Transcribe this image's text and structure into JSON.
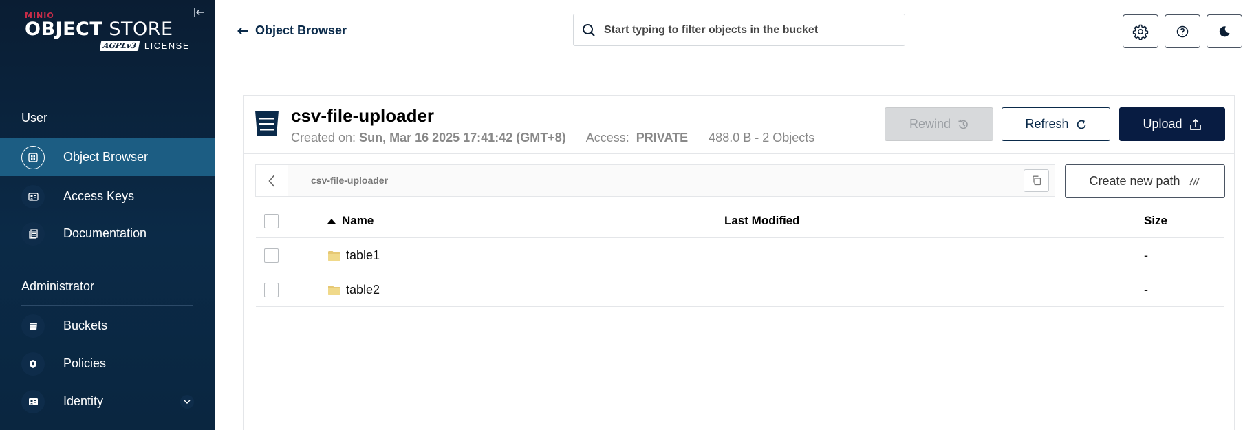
{
  "brand": {
    "minio": "MINIO",
    "title_bold": "OBJECT",
    "title_light": " STORE",
    "agpl": "AGPLv3",
    "license": "LICENSE",
    "colors": {
      "sidebar_bg": "#0b2a47",
      "active_item": "#1c5d83",
      "upload_button": "#081c42",
      "brand_red": "#c72c48"
    }
  },
  "sidebar": {
    "user_section": "User",
    "user_items": [
      {
        "label": "Object Browser",
        "icon": "object-browser-icon",
        "active": true
      },
      {
        "label": "Access Keys",
        "icon": "access-keys-icon",
        "active": false
      },
      {
        "label": "Documentation",
        "icon": "documentation-icon",
        "active": false
      }
    ],
    "admin_section": "Administrator",
    "admin_items": [
      {
        "label": "Buckets",
        "icon": "buckets-icon"
      },
      {
        "label": "Policies",
        "icon": "policies-icon"
      },
      {
        "label": "Identity",
        "icon": "identity-icon",
        "expandable": true
      }
    ]
  },
  "header": {
    "back_label": "Object Browser",
    "search_placeholder": "Start typing to filter objects in the bucket",
    "icons": [
      "settings-icon",
      "help-icon",
      "dark-mode-icon"
    ]
  },
  "bucket": {
    "name": "csv-file-uploader",
    "created_label": "Created on:",
    "created_value": "Sun, Mar 16 2025 17:41:42 (GMT+8)",
    "access_label": "Access:",
    "access_value": "PRIVATE",
    "usage": "488.0 B - 2 Objects",
    "buttons": {
      "rewind": "Rewind",
      "refresh": "Refresh",
      "upload": "Upload"
    }
  },
  "path": {
    "current": "csv-file-uploader",
    "create_new_path": "Create new path"
  },
  "table": {
    "columns": {
      "name": "Name",
      "last_modified": "Last Modified",
      "size": "Size"
    },
    "sort": {
      "column": "name",
      "direction": "ascending"
    },
    "rows": [
      {
        "name": "table1",
        "type": "folder",
        "last_modified": "",
        "size": "-"
      },
      {
        "name": "table2",
        "type": "folder",
        "last_modified": "",
        "size": "-"
      }
    ]
  }
}
